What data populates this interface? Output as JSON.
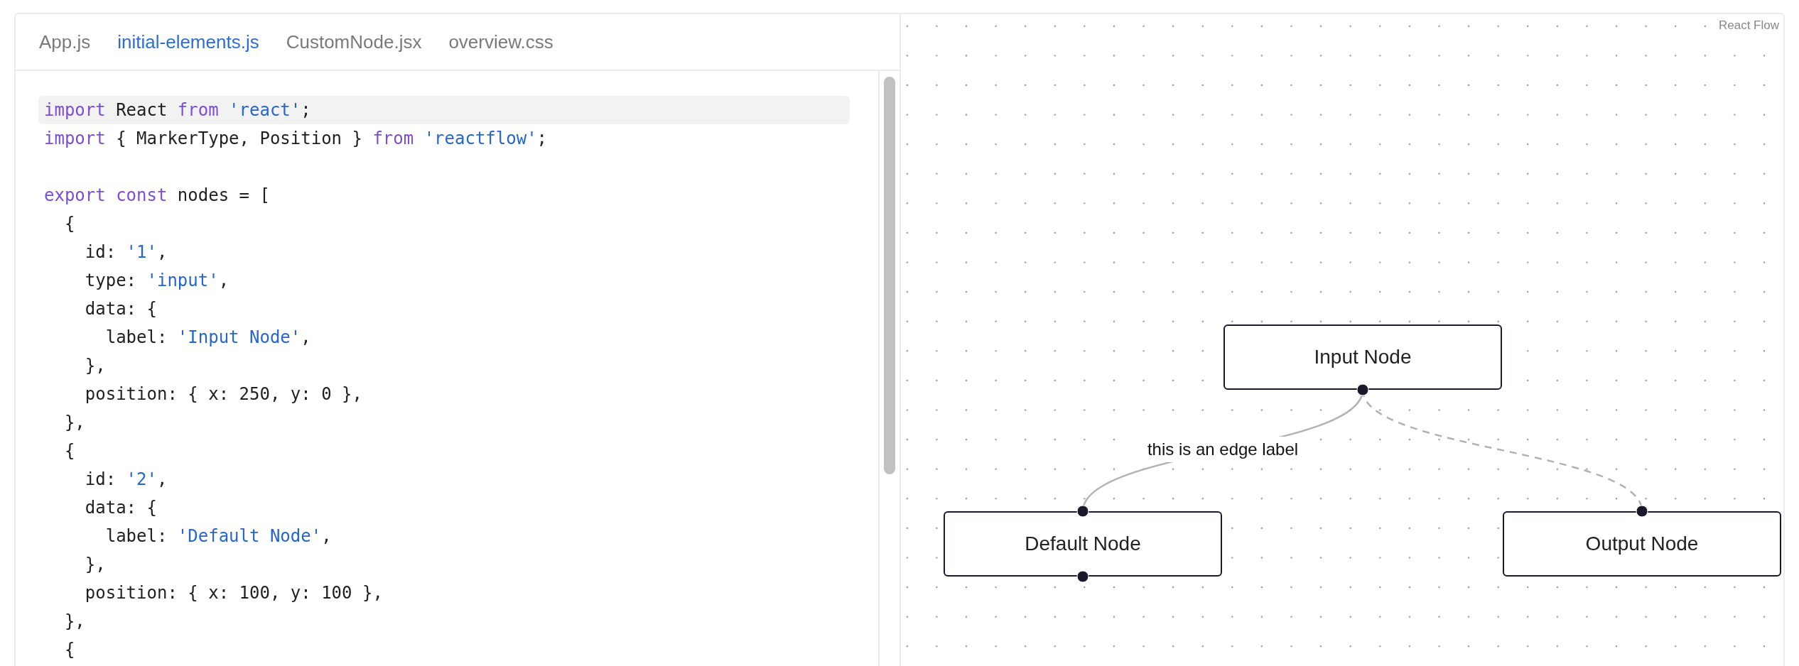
{
  "editor": {
    "tabs": [
      {
        "label": "App.js",
        "selected": false
      },
      {
        "label": "initial-elements.js",
        "selected": true
      },
      {
        "label": "CustomNode.jsx",
        "selected": false
      },
      {
        "label": "overview.css",
        "selected": false
      }
    ],
    "lines": [
      {
        "highlighted": true,
        "tokens": [
          {
            "kind": "keyword",
            "text": "import"
          },
          {
            "kind": "plain",
            "text": " React "
          },
          {
            "kind": "keyword",
            "text": "from"
          },
          {
            "kind": "string",
            "text": " 'react'"
          },
          {
            "kind": "plain",
            "text": ";"
          }
        ]
      },
      {
        "highlighted": false,
        "tokens": [
          {
            "kind": "keyword",
            "text": "import"
          },
          {
            "kind": "plain",
            "text": " { MarkerType, Position } "
          },
          {
            "kind": "keyword",
            "text": "from"
          },
          {
            "kind": "string",
            "text": " 'reactflow'"
          },
          {
            "kind": "plain",
            "text": ";"
          }
        ]
      },
      {
        "highlighted": false
      },
      {
        "highlighted": false,
        "tokens": [
          {
            "kind": "keyword",
            "text": "export const"
          },
          {
            "kind": "plain",
            "text": " nodes = ["
          }
        ]
      },
      {
        "highlighted": false,
        "tokens": [
          {
            "kind": "plain",
            "text": "  {"
          }
        ]
      },
      {
        "highlighted": false,
        "tokens": [
          {
            "kind": "plain",
            "text": "    id: "
          },
          {
            "kind": "string",
            "text": "'1'"
          },
          {
            "kind": "plain",
            "text": ","
          }
        ]
      },
      {
        "highlighted": false,
        "tokens": [
          {
            "kind": "plain",
            "text": "    type: "
          },
          {
            "kind": "string",
            "text": "'input'"
          },
          {
            "kind": "plain",
            "text": ","
          }
        ]
      },
      {
        "highlighted": false,
        "tokens": [
          {
            "kind": "plain",
            "text": "    data: {"
          }
        ]
      },
      {
        "highlighted": false,
        "tokens": [
          {
            "kind": "plain",
            "text": "      label: "
          },
          {
            "kind": "string",
            "text": "'Input Node'"
          },
          {
            "kind": "plain",
            "text": ","
          }
        ]
      },
      {
        "highlighted": false,
        "tokens": [
          {
            "kind": "plain",
            "text": "    },"
          }
        ]
      },
      {
        "highlighted": false,
        "tokens": [
          {
            "kind": "plain",
            "text": "    position: { x: 250, y: 0 },"
          }
        ]
      },
      {
        "highlighted": false,
        "tokens": [
          {
            "kind": "plain",
            "text": "  },"
          }
        ]
      },
      {
        "highlighted": false,
        "tokens": [
          {
            "kind": "plain",
            "text": "  {"
          }
        ]
      },
      {
        "highlighted": false,
        "tokens": [
          {
            "kind": "plain",
            "text": "    id: "
          },
          {
            "kind": "string",
            "text": "'2'"
          },
          {
            "kind": "plain",
            "text": ","
          }
        ]
      },
      {
        "highlighted": false,
        "tokens": [
          {
            "kind": "plain",
            "text": "    data: {"
          }
        ]
      },
      {
        "highlighted": false,
        "tokens": [
          {
            "kind": "plain",
            "text": "      label: "
          },
          {
            "kind": "string",
            "text": "'Default Node'"
          },
          {
            "kind": "plain",
            "text": ","
          }
        ]
      },
      {
        "highlighted": false,
        "tokens": [
          {
            "kind": "plain",
            "text": "    },"
          }
        ]
      },
      {
        "highlighted": false,
        "tokens": [
          {
            "kind": "plain",
            "text": "    position: { x: 100, y: 100 },"
          }
        ]
      },
      {
        "highlighted": false,
        "tokens": [
          {
            "kind": "plain",
            "text": "  },"
          }
        ]
      },
      {
        "highlighted": false,
        "tokens": [
          {
            "kind": "plain",
            "text": "  {"
          }
        ]
      }
    ]
  },
  "flow": {
    "attribution": "React Flow",
    "nodes": [
      {
        "kind": "input",
        "label": "Input Node"
      },
      {
        "kind": "default",
        "label": "Default Node"
      },
      {
        "kind": "output",
        "label": "Output Node"
      }
    ],
    "edges": [
      {
        "kind": "solid",
        "label": "this is an edge label"
      },
      {
        "kind": "dashed"
      }
    ]
  }
}
